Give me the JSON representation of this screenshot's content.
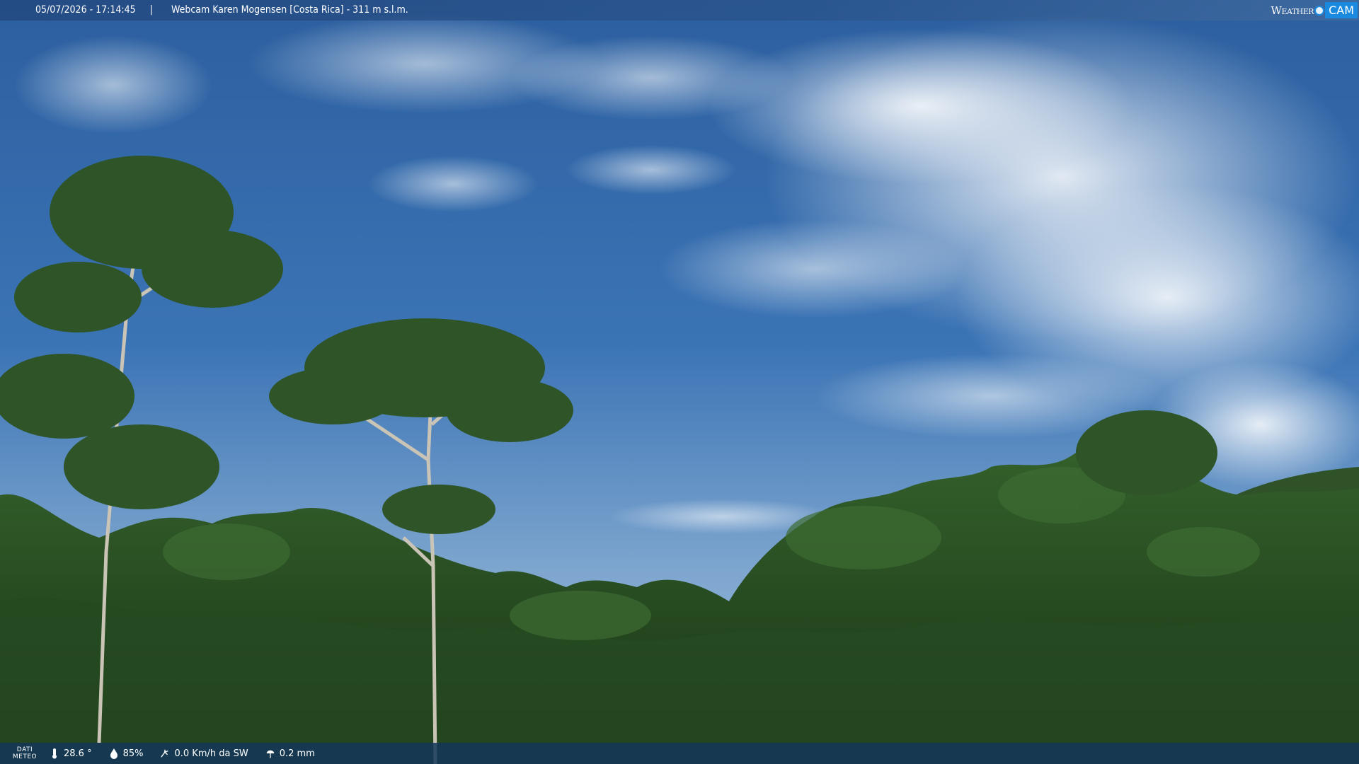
{
  "overlay": {
    "timestamp": "05/07/2026 - 17:14:45",
    "separator": "|",
    "title": "Webcam Karen Mogensen [Costa Rica] - 311 m s.l.m.",
    "logo_weather": "Weather",
    "logo_cam": "CAM"
  },
  "weather": {
    "dati_line1": "DATI",
    "dati_line2": "METEO",
    "temperature": "28.6 °",
    "humidity": "85%",
    "wind": "0.0 Km/h da SW",
    "rain": "0.2 mm"
  },
  "icons": {
    "temperature": "thermometer-icon",
    "humidity": "droplet-icon",
    "wind": "wind-icon",
    "rain": "rain-icon"
  },
  "colors": {
    "sky_top": "#2e64a8",
    "sky_bottom": "#8fb5d8",
    "forest_dark": "#1b3a1a",
    "forest_mid": "#2f5a27",
    "logo_accent": "#1a8ae0"
  }
}
